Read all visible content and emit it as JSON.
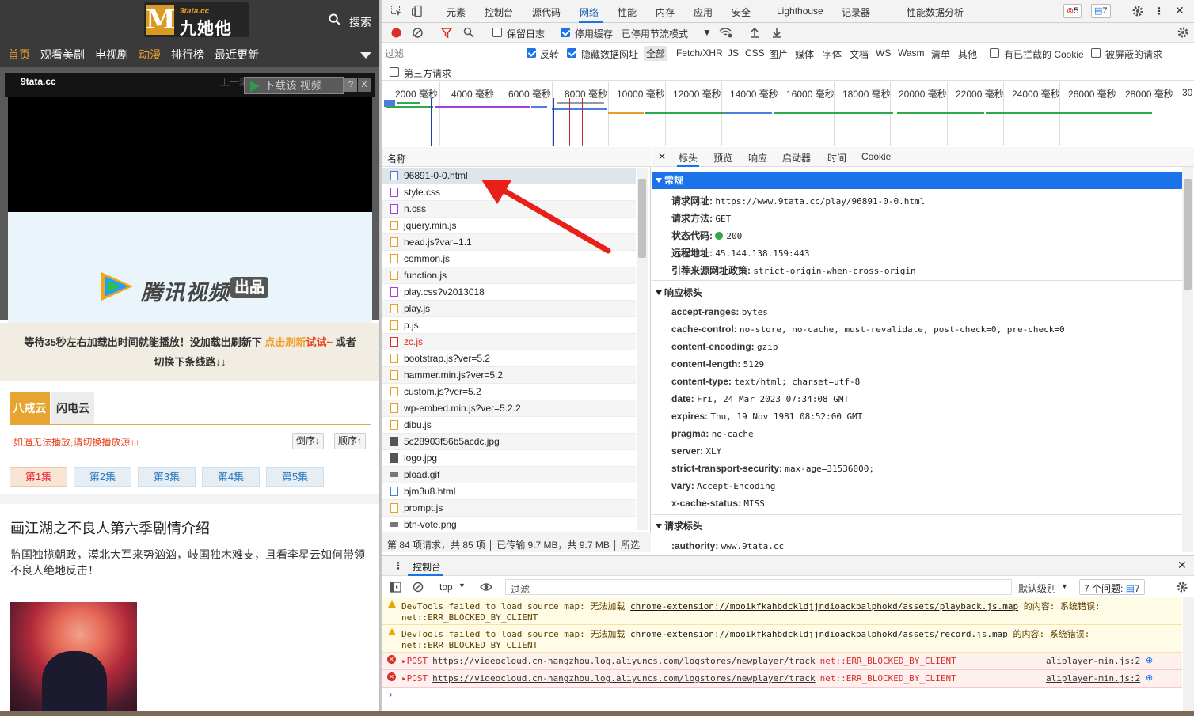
{
  "site": {
    "logo_small": "9tata.cc",
    "logo_text": "九她他",
    "logo_mark": "M",
    "search": "搜索",
    "nav": [
      "首页",
      "观看美剧",
      "电视剧",
      "动漫",
      "排行榜",
      "最近更新"
    ],
    "player": {
      "badge": "9tata.cc",
      "faint_text": "上一集 下一集",
      "download": "下载该 视频",
      "help": "?",
      "close": "X"
    },
    "brand_text": "腾讯视频",
    "brand_badge": "出品",
    "notice": {
      "part1": "等待35秒左右加载出时间就能播放！没加载出刷新下 ",
      "refresh": "点击刷新",
      "try": "试试~",
      "part2": " 或者",
      "line2": "切换下条线路↓↓"
    },
    "lines": [
      "八戒云",
      "闪电云"
    ],
    "hint": "如遇无法播放,请切换播放源↑↑",
    "sort_desc": "倒序↓",
    "sort_asc": "顺序↑",
    "episodes": [
      "第1集",
      "第2集",
      "第3集",
      "第4集",
      "第5集"
    ],
    "synopsis_title": "画江湖之不良人第六季剧情介绍",
    "synopsis": "监国独揽朝政，漠北大军来势汹汹，岐国独木难支，且看李星云如何带领不良人绝地反击！"
  },
  "devtools": {
    "tabs": [
      "元素",
      "控制台",
      "源代码",
      "网络",
      "性能",
      "内存",
      "应用",
      "安全",
      "Lighthouse",
      "记录器",
      "性能数据分析"
    ],
    "error_count": "5",
    "issue_count": "7",
    "toolbar": {
      "preserve_log": "保留日志",
      "disable_cache": "停用缓存",
      "throttle": "已停用节流模式"
    },
    "filter": {
      "placeholder": "过滤",
      "invert": "反转",
      "hide_data": "隐藏数据网址",
      "types": [
        "全部",
        "Fetch/XHR",
        "JS",
        "CSS",
        "图片",
        "媒体",
        "字体",
        "文档",
        "WS",
        "Wasm",
        "清单",
        "其他"
      ],
      "blocked_cookies": "有已拦截的 Cookie",
      "blocked_requests": "被屏蔽的请求",
      "third_party": "第三方请求"
    },
    "timeline_ticks": [
      "2000 毫秒",
      "4000 毫秒",
      "6000 毫秒",
      "8000 毫秒",
      "10000 毫秒",
      "12000 毫秒",
      "14000 毫秒",
      "16000 毫秒",
      "18000 毫秒",
      "20000 毫秒",
      "22000 毫秒",
      "24000 毫秒",
      "26000 毫秒",
      "28000 毫秒",
      "30"
    ],
    "name_header": "名称",
    "requests": [
      {
        "name": "96891-0-0.html",
        "type": "doc"
      },
      {
        "name": "style.css",
        "type": "css"
      },
      {
        "name": "n.css",
        "type": "css"
      },
      {
        "name": "jquery.min.js",
        "type": "js"
      },
      {
        "name": "head.js?var=1.1",
        "type": "js"
      },
      {
        "name": "common.js",
        "type": "js"
      },
      {
        "name": "function.js",
        "type": "js"
      },
      {
        "name": "play.css?v2013018",
        "type": "css"
      },
      {
        "name": "play.js",
        "type": "js"
      },
      {
        "name": "p.js",
        "type": "js"
      },
      {
        "name": "zc.js",
        "type": "jserr"
      },
      {
        "name": "bootstrap.js?ver=5.2",
        "type": "js"
      },
      {
        "name": "hammer.min.js?ver=5.2",
        "type": "js"
      },
      {
        "name": "custom.js?ver=5.2",
        "type": "js"
      },
      {
        "name": "wp-embed.min.js?ver=5.2.2",
        "type": "js"
      },
      {
        "name": "dibu.js",
        "type": "js"
      },
      {
        "name": "5c28903f56b5acdc.jpg",
        "type": "img"
      },
      {
        "name": "logo.jpg",
        "type": "img"
      },
      {
        "name": "pload.gif",
        "type": "dim"
      },
      {
        "name": "bjm3u8.html",
        "type": "doc"
      },
      {
        "name": "prompt.js",
        "type": "js"
      },
      {
        "name": "btn-vote.png",
        "type": "dim"
      }
    ],
    "status_bar": "第 84 项请求，共 85 项 │ 已传输 9.7 MB，共 9.7 MB │ 所选",
    "detail_tabs": [
      "标头",
      "预览",
      "响应",
      "启动器",
      "时间",
      "Cookie"
    ],
    "general_title": "常规",
    "general": [
      {
        "k": "请求网址:",
        "v": "https://www.9tata.cc/play/96891-0-0.html"
      },
      {
        "k": "请求方法:",
        "v": "GET"
      },
      {
        "k": "状态代码:",
        "v": "200"
      },
      {
        "k": "远程地址:",
        "v": "45.144.138.159:443"
      },
      {
        "k": "引荐来源网址政策:",
        "v": "strict-origin-when-cross-origin"
      }
    ],
    "response_title": "响应标头",
    "response_headers": [
      {
        "k": "accept-ranges:",
        "v": "bytes"
      },
      {
        "k": "cache-control:",
        "v": "no-store, no-cache, must-revalidate, post-check=0, pre-check=0"
      },
      {
        "k": "content-encoding:",
        "v": "gzip"
      },
      {
        "k": "content-length:",
        "v": "5129"
      },
      {
        "k": "content-type:",
        "v": "text/html; charset=utf-8"
      },
      {
        "k": "date:",
        "v": "Fri, 24 Mar 2023 07:34:08 GMT"
      },
      {
        "k": "expires:",
        "v": "Thu, 19 Nov 1981 08:52:00 GMT"
      },
      {
        "k": "pragma:",
        "v": "no-cache"
      },
      {
        "k": "server:",
        "v": "XLY"
      },
      {
        "k": "strict-transport-security:",
        "v": "max-age=31536000;"
      },
      {
        "k": "vary:",
        "v": "Accept-Encoding"
      },
      {
        "k": "x-cache-status:",
        "v": "MISS"
      }
    ],
    "request_title": "请求标头",
    "request_headers": [
      {
        "k": ":authority:",
        "v": "www.9tata.cc"
      }
    ],
    "console": {
      "tab": "控制台",
      "context": "top",
      "filter": "过滤",
      "level": "默认级别",
      "issues": "7 个问题:",
      "issue_badge": "7",
      "messages": [
        {
          "level": "warn",
          "line1": "DevTools failed to load source map: 无法加载 ",
          "link": "chrome-extension://mooikfkahbdckldjjndioackbalphokd/assets/playback.js.map",
          "tail": " 的内容: 系统错误:",
          "line2": "net::ERR_BLOCKED_BY_CLIENT"
        },
        {
          "level": "warn",
          "line1": "DevTools failed to load source map: 无法加载 ",
          "link": "chrome-extension://mooikfkahbdckldjjndioackbalphokd/assets/record.js.map",
          "tail": " 的内容: 系统错误:",
          "line2": "net::ERR_BLOCKED_BY_CLIENT"
        },
        {
          "level": "error",
          "method": "▸POST",
          "url": "https://videocloud.cn-hangzhou.log.aliyuncs.com/logstores/newplayer/track",
          "err": "net::ERR_BLOCKED_BY_CLIENT",
          "src": "aliplayer-min.js:2"
        },
        {
          "level": "error",
          "method": "▸POST",
          "url": "https://videocloud.cn-hangzhou.log.aliyuncs.com/logstores/newplayer/track",
          "err": "net::ERR_BLOCKED_BY_CLIENT",
          "src": "aliplayer-min.js:2"
        }
      ],
      "prompt": "›"
    }
  },
  "colors": {
    "accent": "#1a73e8",
    "brand_orange": "#e8a430",
    "error": "#d93025",
    "warning": "#e8a600",
    "status_ok": "#2ea84a",
    "arrow": "#e8201a"
  }
}
